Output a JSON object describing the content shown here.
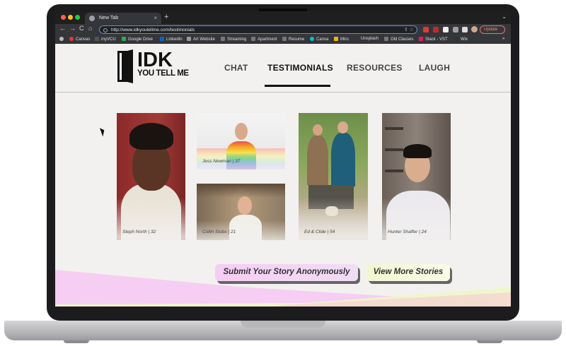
{
  "browser": {
    "tab_title": "New Tab",
    "tab_close": "×",
    "new_tab": "+",
    "tab_menu": "⌄",
    "url": "http://www.idkyoutellme.com/testimonials",
    "update_label": "Update",
    "nav_back": "←",
    "nav_forward": "→",
    "nav_reload": "C",
    "nav_home": "⌂",
    "omni_icons": "⇪ ☆",
    "bookmarks": [
      "Canvas",
      "myVCU",
      "Google Drive",
      "LinkedIn",
      "Art Website",
      "Streaming",
      "Apartment",
      "Resume",
      "Canva",
      "Miro",
      "Unsplash",
      "Old Classes",
      "Slack - VST",
      "Wix"
    ],
    "bookmark_more": "»"
  },
  "site": {
    "logo_main": "IDK",
    "logo_sub": "YOU TELL ME",
    "nav": [
      "CHAT",
      "TESTIMONIALS",
      "RESOURCES",
      "LAUGH"
    ],
    "active_nav": "TESTIMONIALS"
  },
  "testimonials": [
    {
      "caption": "Steph North | 32"
    },
    {
      "caption": "Jess Newman | 37"
    },
    {
      "caption": "Collin Stubs | 21"
    },
    {
      "caption": "Ed & Clide | 54"
    },
    {
      "caption": "Hunter Shaffer | 24"
    }
  ],
  "buttons": {
    "submit": "Submit Your Story Anonymously",
    "more": "View More Stories"
  },
  "colors": {
    "accent_pink": "#f7c8f3",
    "accent_green": "#eef6c8",
    "page_bg": "#f2f1ef"
  }
}
